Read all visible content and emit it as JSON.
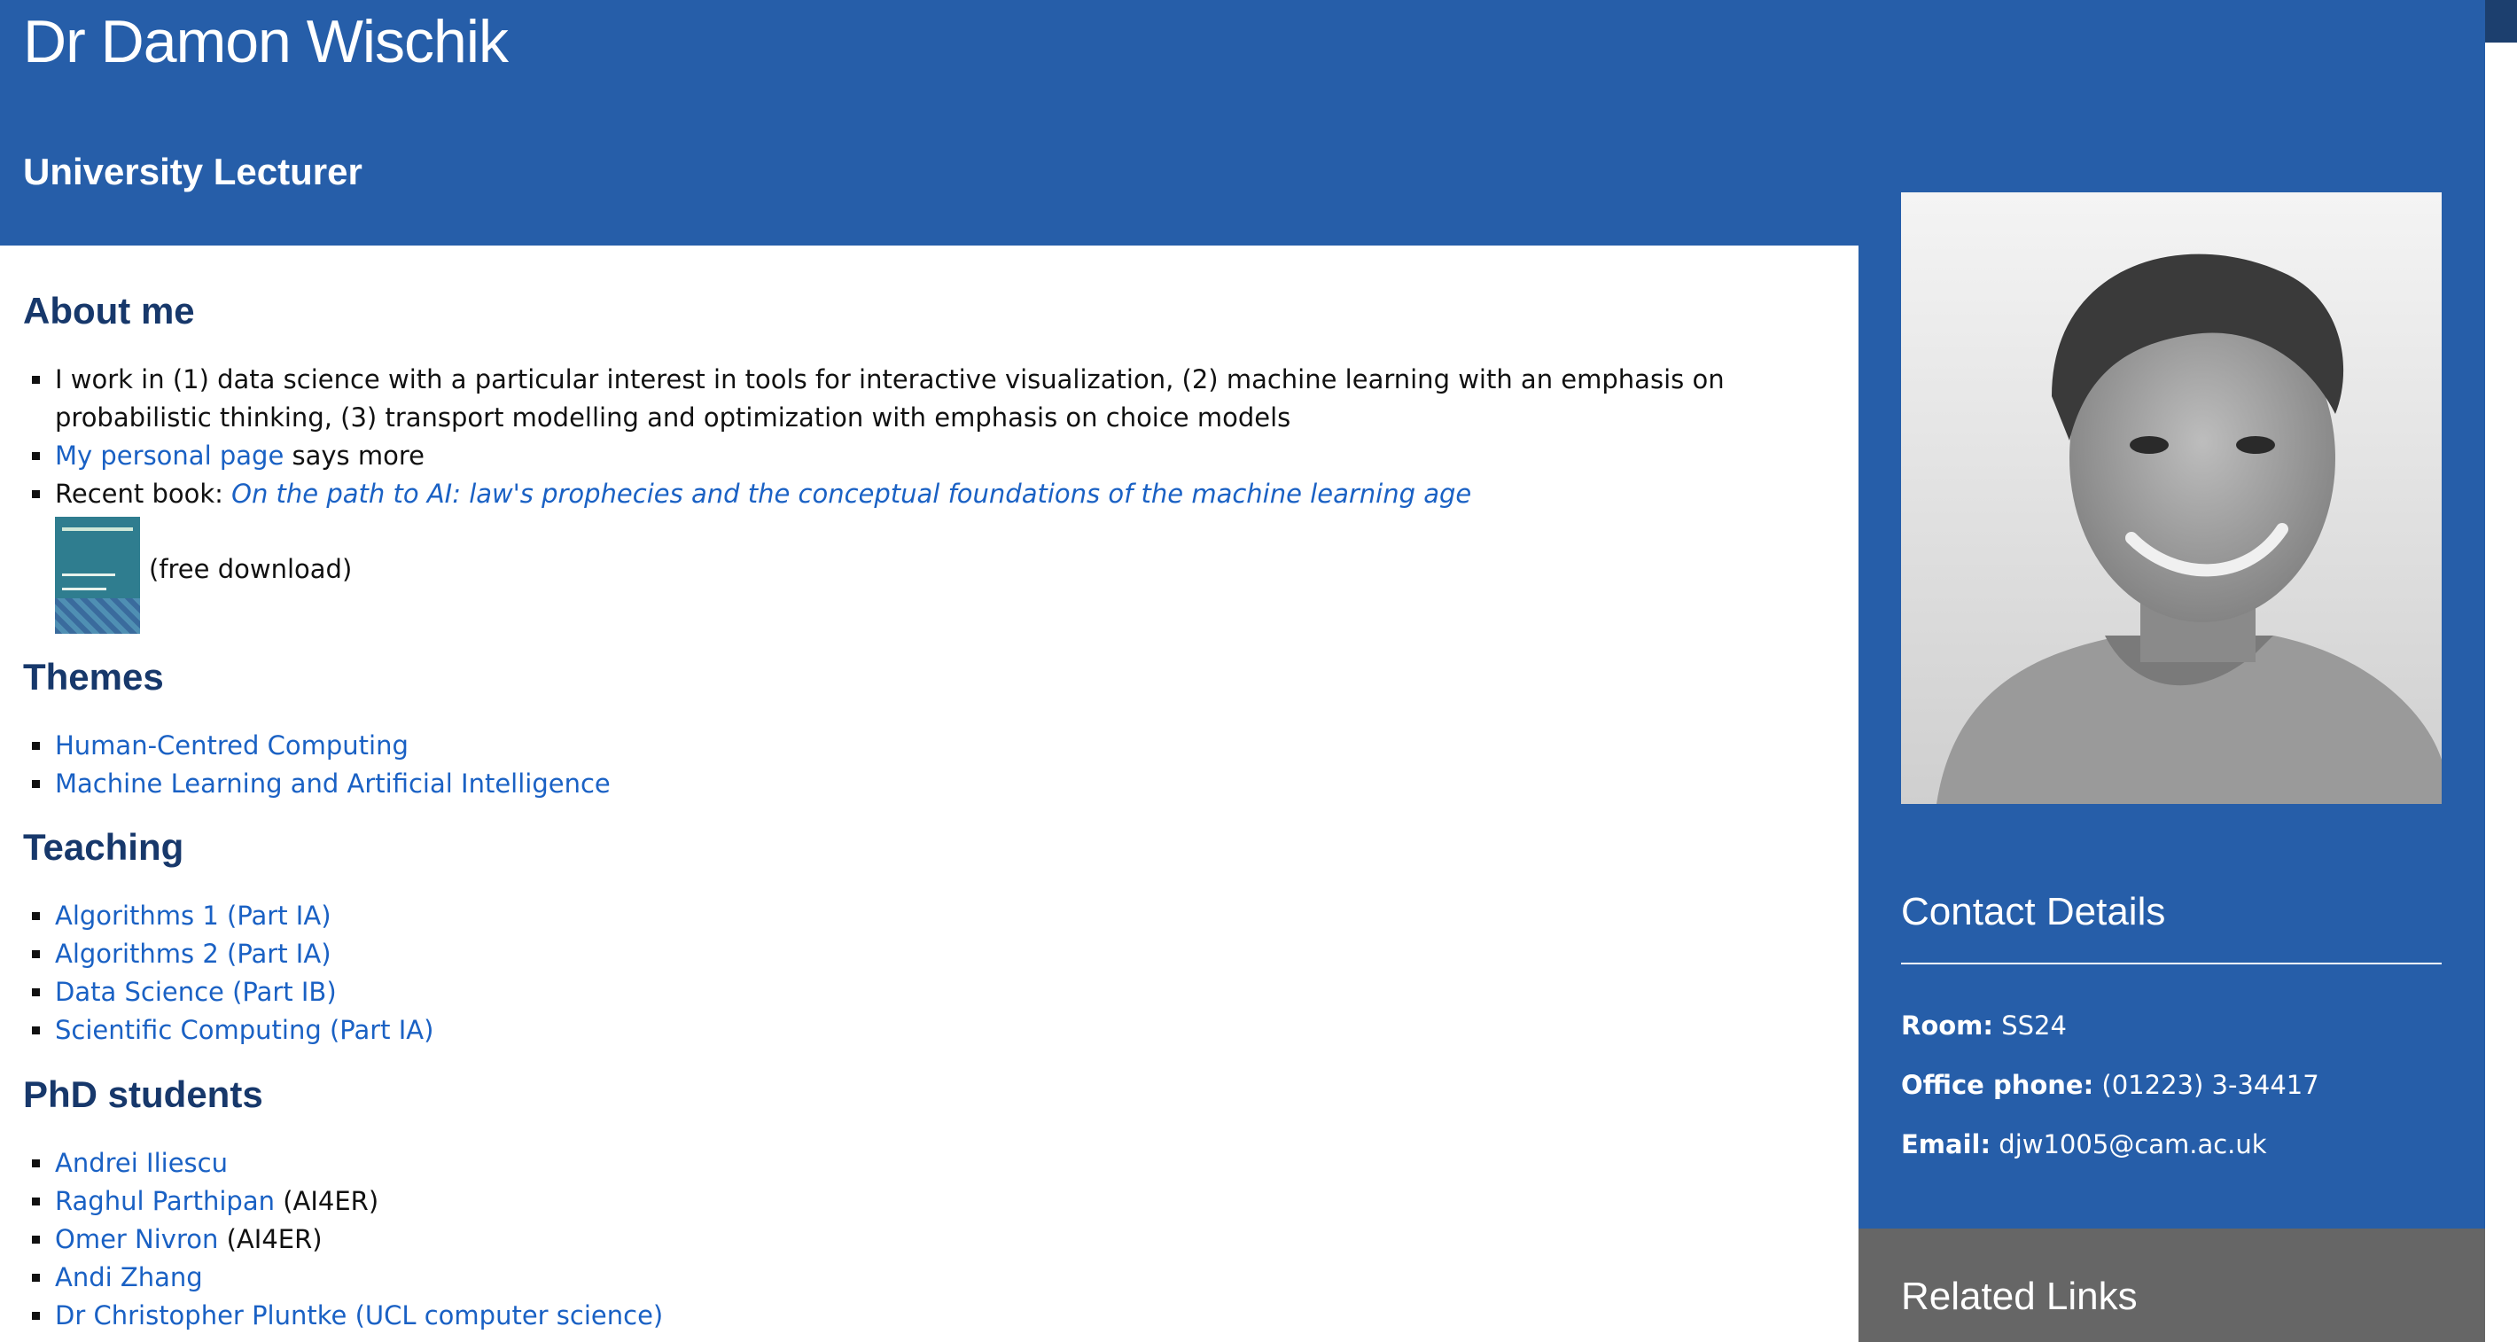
{
  "header": {
    "name": "Dr Damon Wischik",
    "role": "University Lecturer"
  },
  "about": {
    "title": "About me",
    "item1": "I work in (1) data science with a particular interest in tools for interactive visualization, (2) machine learning with an emphasis on probabilistic thinking, (3) transport modelling and optimization with emphasis on choice models",
    "item2_link": "My personal page",
    "item2_text": " says more",
    "item3_prefix": "Recent book: ",
    "item3_link": "On the path to AI: law's prophecies and the conceptual foundations of the machine learning age",
    "book_caption": "(free download)"
  },
  "themes": {
    "title": "Themes",
    "items": [
      "Human-Centred Computing",
      "Machine Learning and Artificial Intelligence"
    ]
  },
  "teaching": {
    "title": "Teaching",
    "items": [
      "Algorithms 1 (Part IA)",
      "Algorithms 2 (Part IA)",
      "Data Science (Part IB)",
      "Scientific Computing (Part IA)"
    ]
  },
  "phd": {
    "title": "PhD students",
    "students": [
      {
        "name": "Andrei Iliescu",
        "note": ""
      },
      {
        "name": "Raghul Parthipan",
        "note": " (AI4ER)"
      },
      {
        "name": "Omer Nivron",
        "note": " (AI4ER)"
      },
      {
        "name": "Andi Zhang",
        "note": ""
      },
      {
        "name": "Dr Christopher Pluntke (UCL computer science)",
        "note": ""
      }
    ]
  },
  "contact": {
    "title": "Contact Details",
    "room_label": "Room:",
    "room_value": " SS24",
    "phone_label": "Office phone:",
    "phone_value": " (01223) 3-34417",
    "email_label": "Email:",
    "email_value": " djw1005@cam.ac.uk"
  },
  "related": {
    "title": "Related Links"
  },
  "colors": {
    "header_blue": "#265ea9",
    "heading_navy": "#17386b",
    "link_blue": "#1a61c4",
    "related_gray": "#666666"
  }
}
